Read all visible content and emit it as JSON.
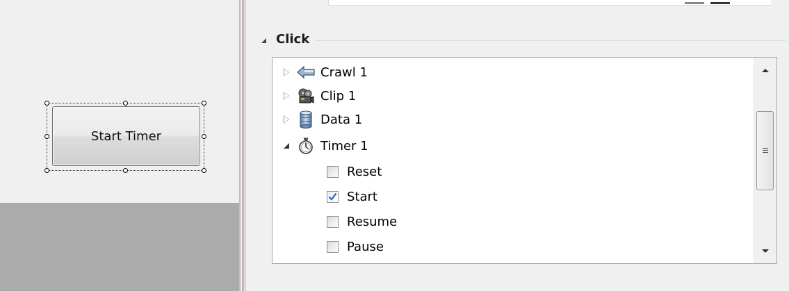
{
  "designer": {
    "selected_button_label": "Start Timer"
  },
  "events": {
    "group_label": "Click",
    "tree": [
      {
        "label": "Crawl 1",
        "icon": "arrow-left-icon",
        "expander": "collapsed"
      },
      {
        "label": "Clip 1",
        "icon": "film-reel-icon",
        "expander": "collapsed"
      },
      {
        "label": "Data 1",
        "icon": "database-icon",
        "expander": "collapsed"
      },
      {
        "label": "Timer 1",
        "icon": "stopwatch-icon",
        "expander": "expanded"
      }
    ],
    "timer_actions": [
      {
        "label": "Reset",
        "checked": false
      },
      {
        "label": "Start",
        "checked": true
      },
      {
        "label": "Resume",
        "checked": false
      },
      {
        "label": "Pause",
        "checked": false
      }
    ]
  },
  "colors": {
    "check_mark": "#3a6fc4",
    "design_gray": "#ababab",
    "panel_bg": "#f0f0f0"
  }
}
